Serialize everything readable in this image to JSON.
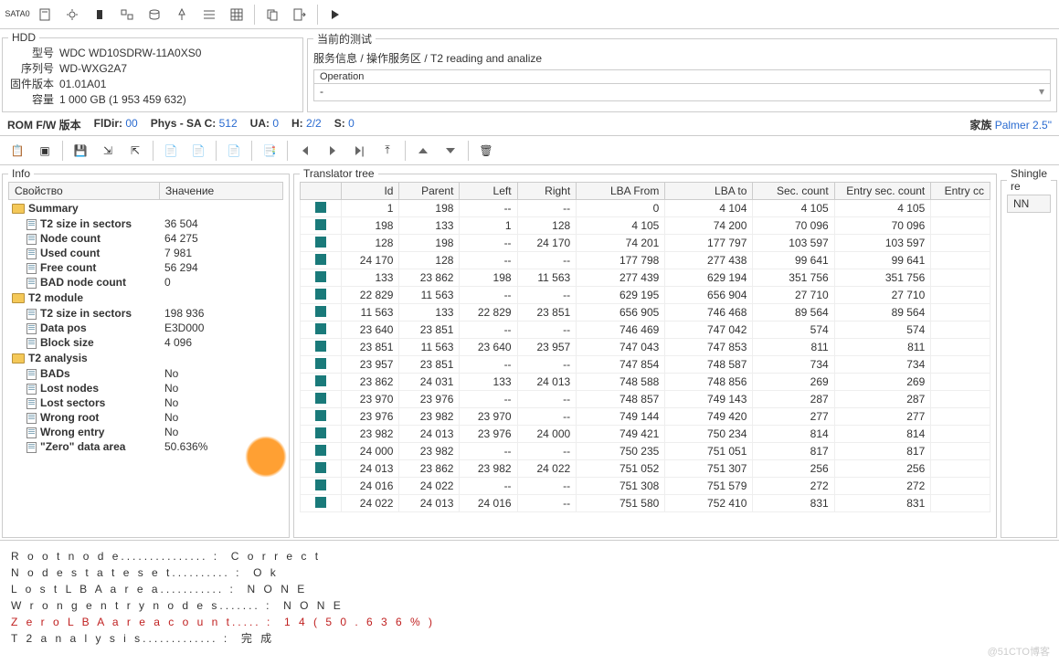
{
  "toolbar": {
    "sata": "SATA0"
  },
  "hdd": {
    "title": "HDD",
    "model_k": "型号",
    "model_v": "WDC WD10SDRW-11A0XS0",
    "serial_k": "序列号",
    "serial_v": "WD-WXG2A7",
    "fw_k": "固件版本",
    "fw_v": "01.01A01",
    "cap_k": "容量",
    "cap_v": "1 000 GB (1 953 459 632)"
  },
  "test": {
    "title": "当前的测试",
    "path": "服务信息 / 操作服务区 / T2 reading and analize",
    "op": "Operation",
    "opv": "-"
  },
  "status": {
    "romfw": "ROM F/W 版本",
    "fldir": "FlDir:",
    "fldir_v": "00",
    "phys": "Phys - SA C:",
    "phys_v": "512",
    "ua": "UA:",
    "ua_v": "0",
    "h": "H:",
    "h_v": "2/2",
    "s": "S:",
    "s_v": "0",
    "fam": "家族",
    "fam_v": "Palmer 2.5\""
  },
  "info": {
    "title": "Info",
    "prop": "Свойство",
    "val": "Значение",
    "items": [
      {
        "t": "f",
        "l": "Summary"
      },
      {
        "t": "d",
        "l": "T2 size in sectors",
        "v": "36 504"
      },
      {
        "t": "d",
        "l": "Node count",
        "v": "64 275"
      },
      {
        "t": "d",
        "l": "Used count",
        "v": "7 981"
      },
      {
        "t": "d",
        "l": "Free count",
        "v": "56 294"
      },
      {
        "t": "d",
        "l": "BAD node count",
        "v": "0"
      },
      {
        "t": "f",
        "l": "T2 module"
      },
      {
        "t": "d",
        "l": "T2 size in sectors",
        "v": "198 936"
      },
      {
        "t": "d",
        "l": "Data pos",
        "v": "E3D000"
      },
      {
        "t": "d",
        "l": "Block size",
        "v": "4 096"
      },
      {
        "t": "f",
        "l": "T2 analysis"
      },
      {
        "t": "d",
        "l": "BADs",
        "v": "No"
      },
      {
        "t": "d",
        "l": "Lost nodes",
        "v": "No"
      },
      {
        "t": "d",
        "l": "Lost sectors",
        "v": "No"
      },
      {
        "t": "d",
        "l": "Wrong root",
        "v": "No"
      },
      {
        "t": "d",
        "l": "Wrong entry",
        "v": "No"
      },
      {
        "t": "d",
        "l": "\"Zero\" data area",
        "v": "50.636%"
      }
    ]
  },
  "tree": {
    "title": "Translator tree",
    "cols": [
      "",
      "Id",
      "Parent",
      "Left",
      "Right",
      "LBA From",
      "LBA to",
      "Sec. count",
      "Entry sec. count",
      "Entry cc"
    ],
    "rows": [
      [
        "1",
        "198",
        "--",
        "--",
        "0",
        "4 104",
        "4 105",
        "4 105"
      ],
      [
        "198",
        "133",
        "1",
        "128",
        "4 105",
        "74 200",
        "70 096",
        "70 096"
      ],
      [
        "128",
        "198",
        "--",
        "24 170",
        "74 201",
        "177 797",
        "103 597",
        "103 597"
      ],
      [
        "24 170",
        "128",
        "--",
        "--",
        "177 798",
        "277 438",
        "99 641",
        "99 641"
      ],
      [
        "133",
        "23 862",
        "198",
        "11 563",
        "277 439",
        "629 194",
        "351 756",
        "351 756"
      ],
      [
        "22 829",
        "11 563",
        "--",
        "--",
        "629 195",
        "656 904",
        "27 710",
        "27 710"
      ],
      [
        "11 563",
        "133",
        "22 829",
        "23 851",
        "656 905",
        "746 468",
        "89 564",
        "89 564"
      ],
      [
        "23 640",
        "23 851",
        "--",
        "--",
        "746 469",
        "747 042",
        "574",
        "574"
      ],
      [
        "23 851",
        "11 563",
        "23 640",
        "23 957",
        "747 043",
        "747 853",
        "811",
        "811"
      ],
      [
        "23 957",
        "23 851",
        "--",
        "--",
        "747 854",
        "748 587",
        "734",
        "734"
      ],
      [
        "23 862",
        "24 031",
        "133",
        "24 013",
        "748 588",
        "748 856",
        "269",
        "269"
      ],
      [
        "23 970",
        "23 976",
        "--",
        "--",
        "748 857",
        "749 143",
        "287",
        "287"
      ],
      [
        "23 976",
        "23 982",
        "23 970",
        "--",
        "749 144",
        "749 420",
        "277",
        "277"
      ],
      [
        "23 982",
        "24 013",
        "23 976",
        "24 000",
        "749 421",
        "750 234",
        "814",
        "814"
      ],
      [
        "24 000",
        "23 982",
        "--",
        "--",
        "750 235",
        "751 051",
        "817",
        "817"
      ],
      [
        "24 013",
        "23 862",
        "23 982",
        "24 022",
        "751 052",
        "751 307",
        "256",
        "256"
      ],
      [
        "24 016",
        "24 022",
        "--",
        "--",
        "751 308",
        "751 579",
        "272",
        "272"
      ],
      [
        "24 022",
        "24 013",
        "24 016",
        "--",
        "751 580",
        "752 410",
        "831",
        "831"
      ]
    ]
  },
  "sh": {
    "title": "Shingle re",
    "col": "NN"
  },
  "log": [
    {
      "k": "Root node",
      "v": "Correct"
    },
    {
      "k": "Node state set",
      "v": "Ok"
    },
    {
      "k": "Lost LBA area",
      "v": "NONE"
    },
    {
      "k": "Wrong entry nodes",
      "v": "NONE"
    },
    {
      "k": "Zero LBA area count",
      "v": "14 (50.636%)",
      "red": true
    },
    {
      "k": "T2 analysis",
      "v": "完成"
    }
  ],
  "watermark": "@51CTO博客"
}
